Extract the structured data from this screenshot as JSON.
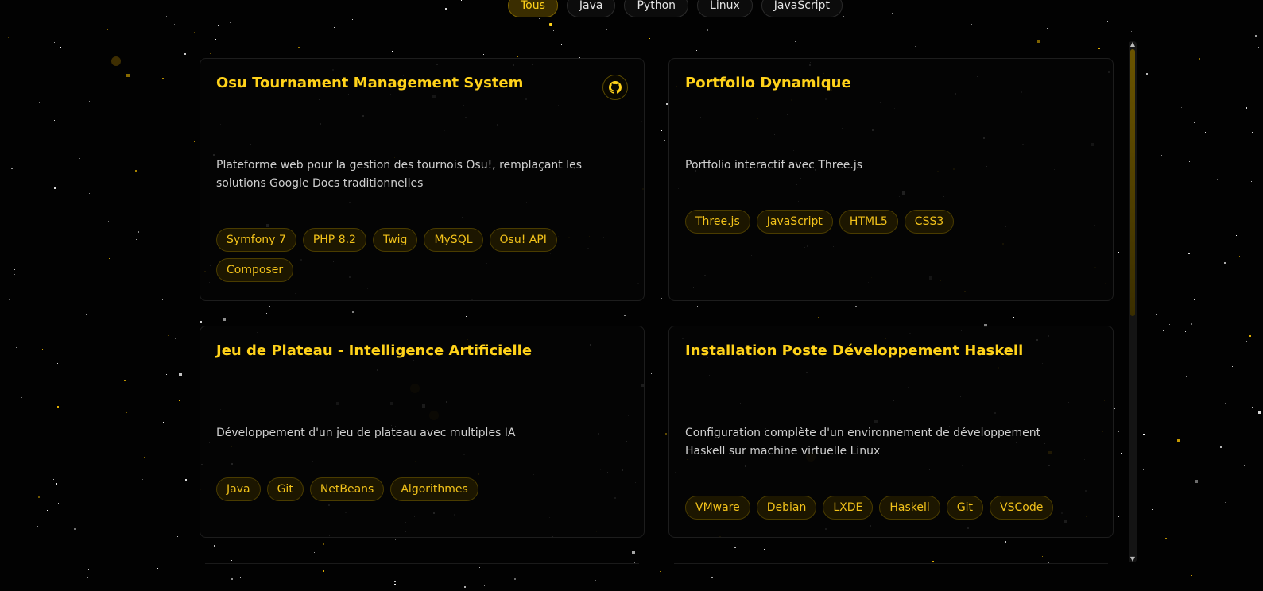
{
  "filters": [
    "Tous",
    "Java",
    "Python",
    "Linux",
    "JavaScript"
  ],
  "active_filter": "Tous",
  "colors": {
    "accent": "#ffd21a",
    "tag_bg": "#1c1600",
    "tag_border": "#4a3c00",
    "background": "#020202"
  },
  "icons": {
    "github": "github-icon",
    "scroll_up": "chevron-up-icon",
    "scroll_down": "chevron-down-icon"
  },
  "projects": [
    {
      "title": "Osu Tournament Management System",
      "description": "Plateforme web pour la gestion des tournois Osu!, remplaçant les solutions Google Docs traditionnelles",
      "tags": [
        "Symfony 7",
        "PHP 8.2",
        "Twig",
        "MySQL",
        "Osu! API",
        "Composer"
      ],
      "has_github": true
    },
    {
      "title": "Portfolio Dynamique",
      "description": "Portfolio interactif avec Three.js",
      "tags": [
        "Three.js",
        "JavaScript",
        "HTML5",
        "CSS3"
      ],
      "has_github": false
    },
    {
      "title": "Jeu de Plateau - Intelligence Artificielle",
      "description": "Développement d'un jeu de plateau avec multiples IA",
      "tags": [
        "Java",
        "Git",
        "NetBeans",
        "Algorithmes"
      ],
      "has_github": false
    },
    {
      "title": "Installation Poste Développement Haskell",
      "description": "Configuration complète d'un environnement de développement Haskell sur machine virtuelle Linux",
      "tags": [
        "VMware",
        "Debian",
        "LXDE",
        "Haskell",
        "Git",
        "VSCode"
      ],
      "has_github": false
    }
  ]
}
